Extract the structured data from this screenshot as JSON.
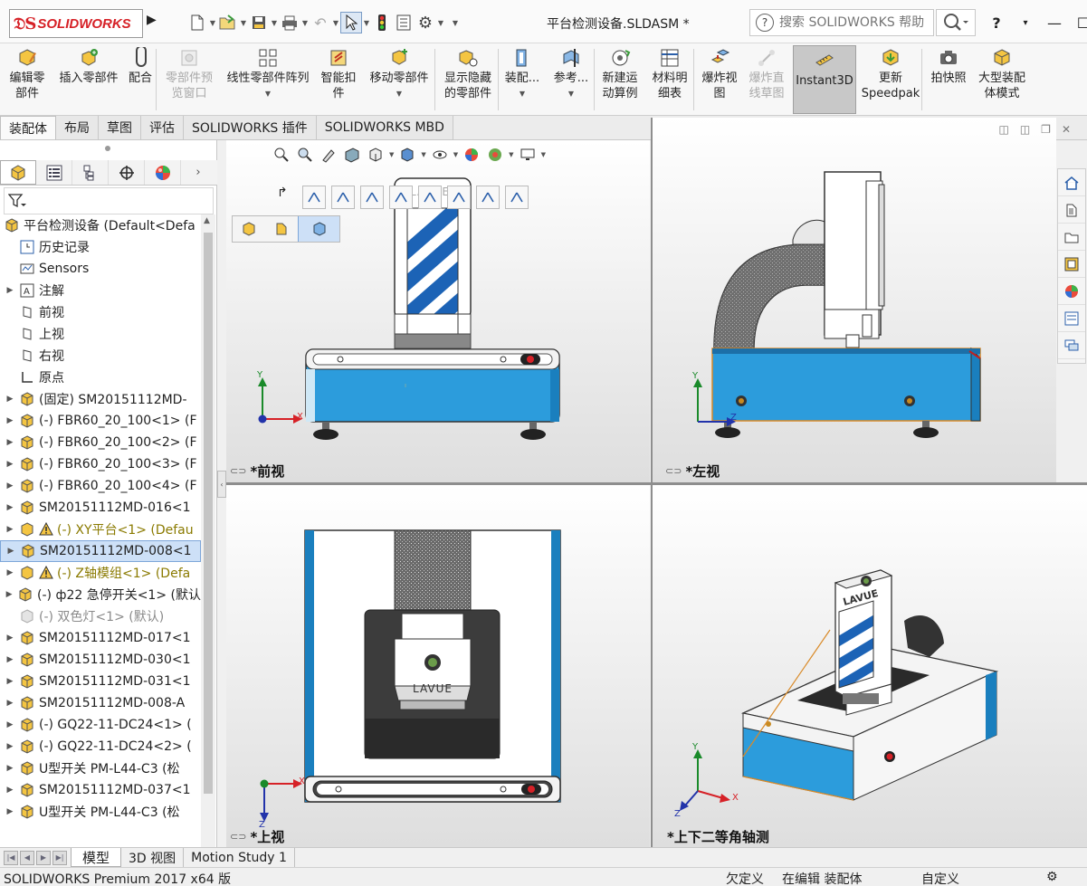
{
  "app": {
    "brand": "SOLIDWORKS",
    "document_title": "平台检测设备.SLDASM *",
    "search_placeholder": "搜索 SOLIDWORKS 帮助"
  },
  "ribbon": [
    {
      "id": "edit-component",
      "label": "编辑零\n部件",
      "enabled": true
    },
    {
      "id": "insert-components",
      "label": "插入零部件",
      "enabled": true
    },
    {
      "id": "mate",
      "label": "配合",
      "enabled": true
    },
    {
      "id": "component-preview",
      "label": "零部件预\n览窗口",
      "enabled": false
    },
    {
      "id": "linear-pattern",
      "label": "线性零部件阵列",
      "enabled": true
    },
    {
      "id": "smart-fasteners",
      "label": "智能扣\n件",
      "enabled": true
    },
    {
      "id": "move-component",
      "label": "移动零部件",
      "enabled": true
    },
    {
      "id": "show-hidden",
      "label": "显示隐藏\n的零部件",
      "enabled": true
    },
    {
      "id": "assembly-features",
      "label": "装配...",
      "enabled": true
    },
    {
      "id": "reference-geometry",
      "label": "参考...",
      "enabled": true
    },
    {
      "id": "new-motion-study",
      "label": "新建运\n动算例",
      "enabled": true
    },
    {
      "id": "bom",
      "label": "材料明\n细表",
      "enabled": true
    },
    {
      "id": "exploded-view",
      "label": "爆炸视\n图",
      "enabled": true
    },
    {
      "id": "explode-line-sketch",
      "label": "爆炸直\n线草图",
      "enabled": false
    },
    {
      "id": "instant3d",
      "label": "Instant3D",
      "enabled": true
    },
    {
      "id": "update-speedpak",
      "label": "更新\nSpeedpak",
      "enabled": true
    },
    {
      "id": "take-snapshot",
      "label": "拍快照",
      "enabled": true
    },
    {
      "id": "large-assembly-mode",
      "label": "大型装配\n体模式",
      "enabled": true
    }
  ],
  "command_tabs": [
    "装配体",
    "布局",
    "草图",
    "评估",
    "SOLIDWORKS 插件",
    "SOLIDWORKS MBD"
  ],
  "tree": {
    "root": "平台检测设备  (Default<Defa",
    "items": [
      {
        "label": "历史记录",
        "kind": "history",
        "expand": false
      },
      {
        "label": "Sensors",
        "kind": "sensor",
        "expand": false
      },
      {
        "label": "注解",
        "kind": "annotation",
        "expand": true
      },
      {
        "label": "前视",
        "kind": "plane",
        "expand": false
      },
      {
        "label": "上视",
        "kind": "plane",
        "expand": false
      },
      {
        "label": "右视",
        "kind": "plane",
        "expand": false
      },
      {
        "label": "原点",
        "kind": "origin",
        "expand": false
      },
      {
        "label": "(固定) SM20151112MD-",
        "kind": "part",
        "expand": true
      },
      {
        "label": "(-) FBR60_20_100<1> (F",
        "kind": "part",
        "expand": true
      },
      {
        "label": "(-) FBR60_20_100<2> (F",
        "kind": "part",
        "expand": true
      },
      {
        "label": "(-) FBR60_20_100<3> (F",
        "kind": "part",
        "expand": true
      },
      {
        "label": "(-) FBR60_20_100<4> (F",
        "kind": "part",
        "expand": true
      },
      {
        "label": "SM20151112MD-016<1",
        "kind": "part",
        "expand": true
      },
      {
        "label": "(-) XY平台<1> (Defau",
        "kind": "warn",
        "expand": true
      },
      {
        "label": "SM20151112MD-008<1",
        "kind": "part",
        "expand": true,
        "selected": true
      },
      {
        "label": "(-) Z轴模组<1> (Defa",
        "kind": "warn",
        "expand": true
      },
      {
        "label": "(-) ф22 急停开关<1> (默认",
        "kind": "part",
        "expand": true
      },
      {
        "label": "(-) 双色灯<1> (默认)",
        "kind": "grey",
        "expand": false
      },
      {
        "label": "SM20151112MD-017<1",
        "kind": "part",
        "expand": true
      },
      {
        "label": "SM20151112MD-030<1",
        "kind": "part",
        "expand": true
      },
      {
        "label": "SM20151112MD-031<1",
        "kind": "part",
        "expand": true
      },
      {
        "label": "SM20151112MD-008-A",
        "kind": "part",
        "expand": true
      },
      {
        "label": "(-) GQ22-11-DC24<1> (",
        "kind": "part",
        "expand": true
      },
      {
        "label": "(-) GQ22-11-DC24<2> (",
        "kind": "part",
        "expand": true
      },
      {
        "label": "U型开关 PM-L44-C3 (松",
        "kind": "part",
        "expand": true
      },
      {
        "label": "SM20151112MD-037<1",
        "kind": "part",
        "expand": true
      },
      {
        "label": "U型开关 PM-L44-C3 (松",
        "kind": "part",
        "expand": true
      }
    ]
  },
  "viewports": {
    "front": "*前视",
    "left": "*左视",
    "top": "*上视",
    "trimetric": "*上下二等角轴测"
  },
  "model": {
    "brand_text": "LAVUE",
    "axis_x": "X",
    "axis_y": "Y",
    "axis_z": "Z"
  },
  "bottom_tabs": [
    "模型",
    "3D 视图",
    "Motion Study 1"
  ],
  "status": {
    "product": "SOLIDWORKS Premium 2017 x64 版",
    "definition": "欠定义",
    "editing": "在编辑 装配体",
    "units": "自定义"
  },
  "colors": {
    "accent_blue": "#2c9cdc",
    "brand_red": "#d62127",
    "selection": "#cde0f7"
  }
}
